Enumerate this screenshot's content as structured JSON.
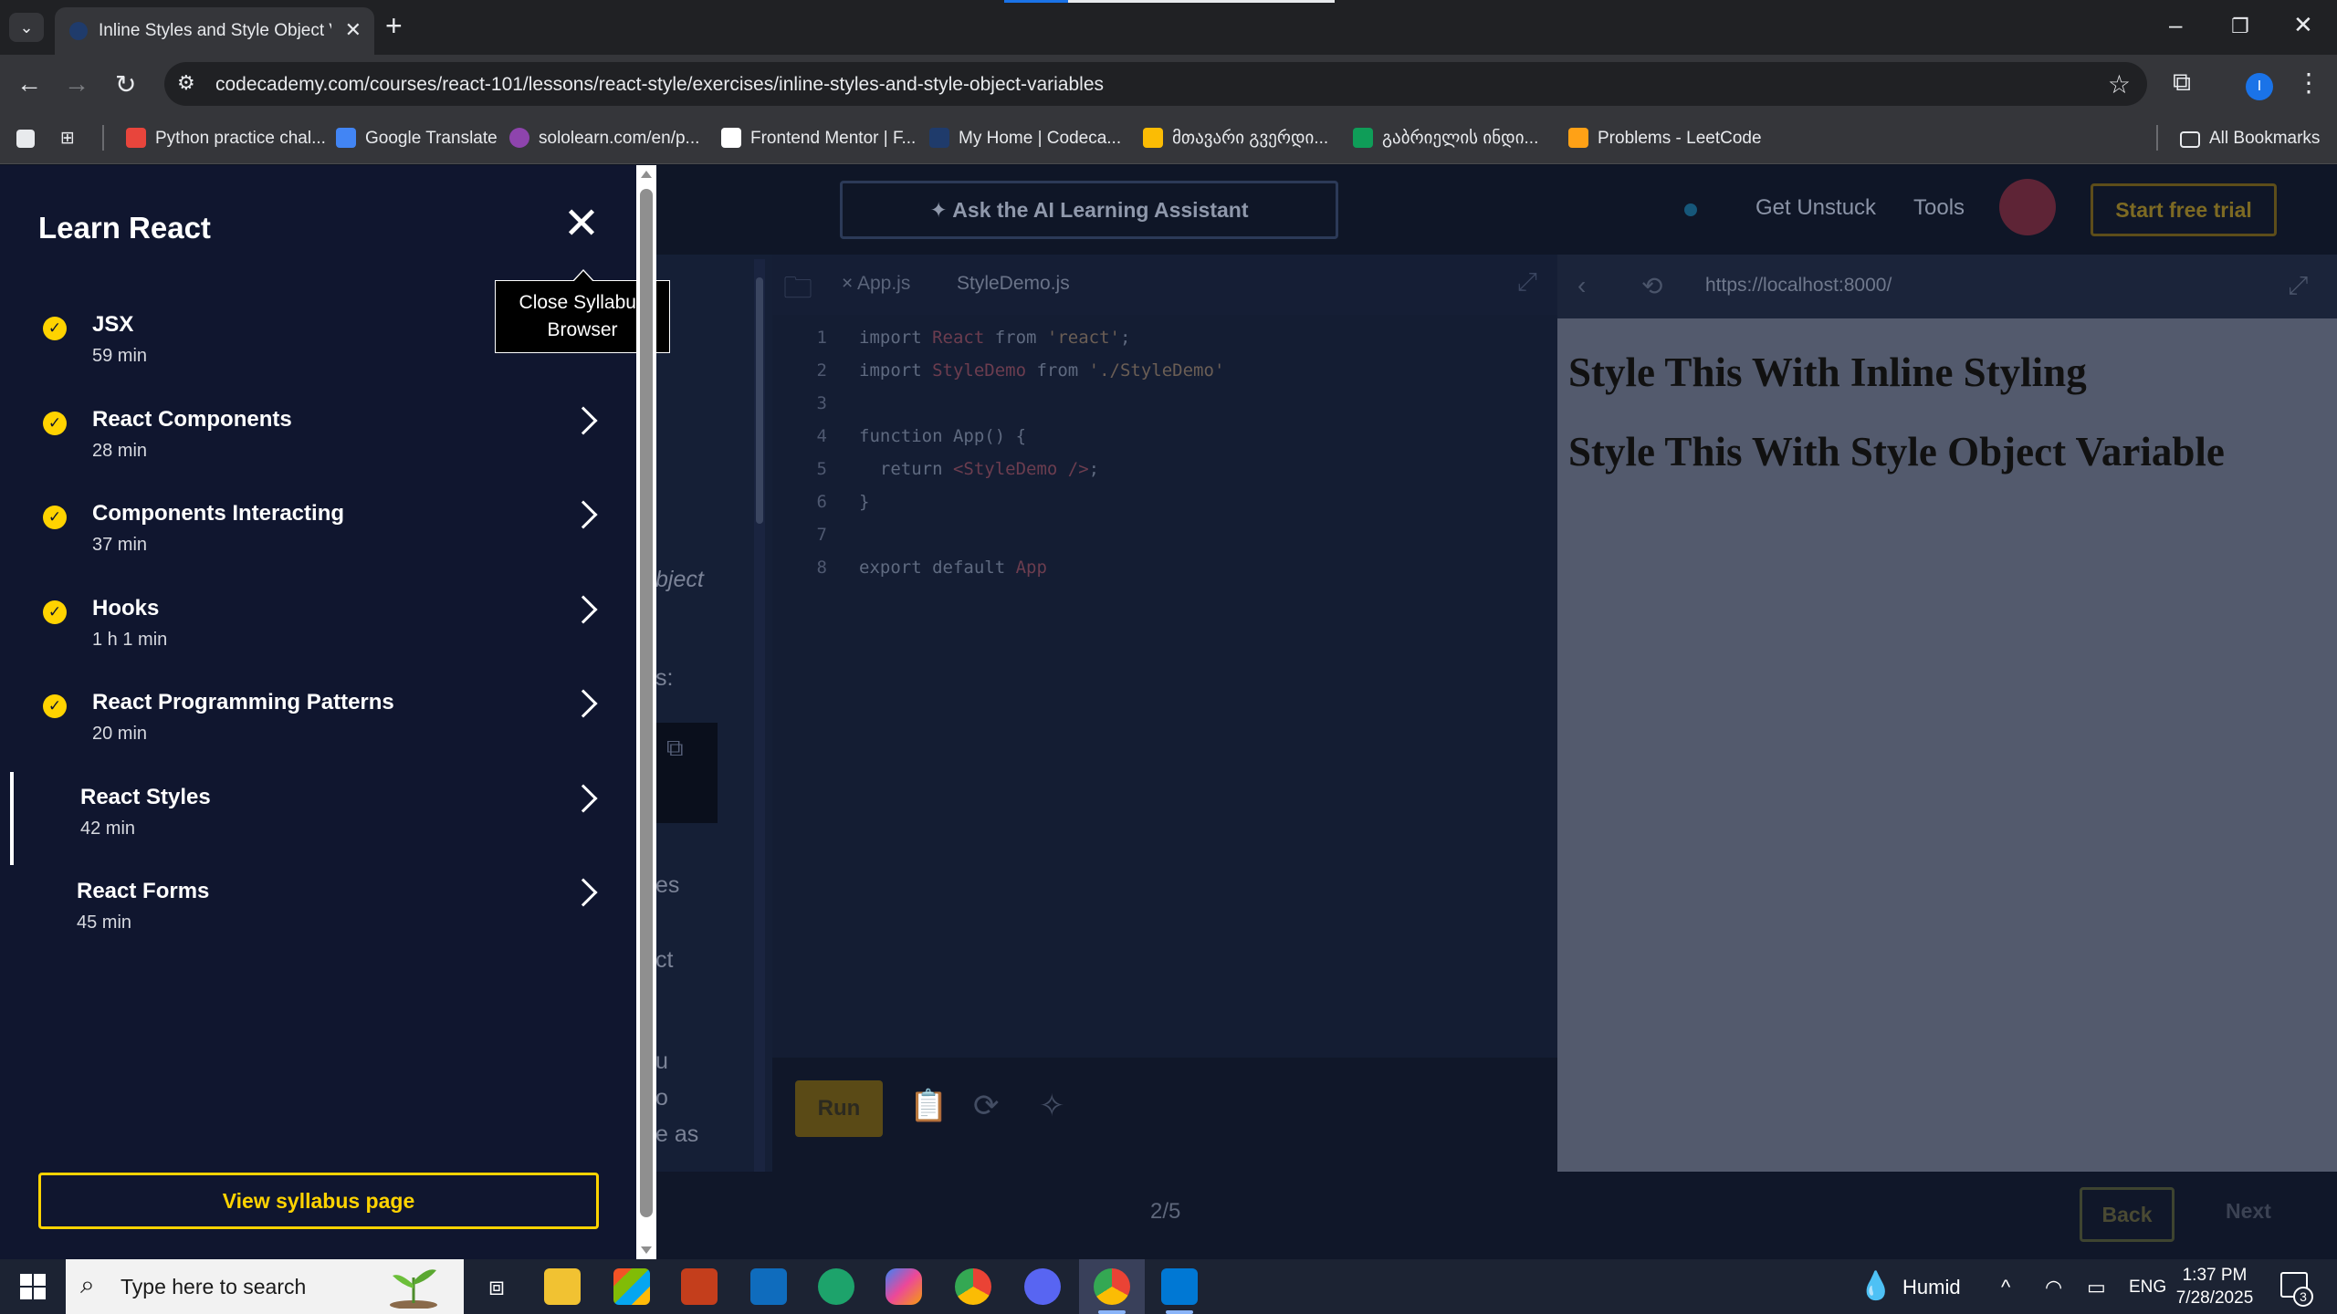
{
  "browser": {
    "tab_title": "Inline Styles and Style Object Va",
    "url": "codecademy.com/courses/react-101/lessons/react-style/exercises/inline-styles-and-style-object-variables",
    "bookmarks": [
      {
        "label": "Python practice chal...",
        "color": "#e8453c"
      },
      {
        "label": "Google Translate",
        "color": "#4285f4"
      },
      {
        "label": "sololearn.com/en/p...",
        "color": "#8e44ad"
      },
      {
        "label": "Frontend Mentor | F...",
        "color": "#ffffff"
      },
      {
        "label": "My Home | Codeca...",
        "color": "#1f3b6b"
      },
      {
        "label": "მთავარი გვერდი...",
        "color": "#fbbc04"
      },
      {
        "label": "გაბრიელის ინდი...",
        "color": "#0f9d58"
      },
      {
        "label": "Problems - LeetCode",
        "color": "#ffa116"
      }
    ],
    "all_bookmarks": "All Bookmarks",
    "profile_initial": "I"
  },
  "nav": {
    "ai_assistant": "Ask the AI Learning Assistant",
    "get_unstuck": "Get Unstuck",
    "tools": "Tools",
    "start_trial": "Start free trial"
  },
  "lesson": {
    "fragments": [
      "bject",
      "s:",
      "es",
      "ct",
      "u",
      "o",
      "e as"
    ]
  },
  "editor": {
    "tabs": [
      "App.js",
      "StyleDemo.js"
    ],
    "run": "Run",
    "lines": [
      {
        "n": "1",
        "parts": [
          [
            "kw",
            "import "
          ],
          [
            "id",
            "React"
          ],
          [
            "kw",
            " from "
          ],
          [
            "str",
            "'react'"
          ],
          [
            "kw",
            ";"
          ]
        ]
      },
      {
        "n": "2",
        "parts": [
          [
            "kw",
            "import "
          ],
          [
            "id",
            "StyleDemo"
          ],
          [
            "kw",
            " from "
          ],
          [
            "str",
            "'./StyleDemo'"
          ]
        ]
      },
      {
        "n": "3",
        "parts": []
      },
      {
        "n": "4",
        "parts": [
          [
            "kw",
            "function App() {"
          ]
        ]
      },
      {
        "n": "5",
        "parts": [
          [
            "kw",
            "  return "
          ],
          [
            "id",
            "<StyleDemo />"
          ],
          [
            "kw",
            ";"
          ]
        ]
      },
      {
        "n": "6",
        "parts": [
          [
            "kw",
            "}"
          ]
        ]
      },
      {
        "n": "7",
        "parts": []
      },
      {
        "n": "8",
        "parts": [
          [
            "kw",
            "export default "
          ],
          [
            "id",
            "App"
          ]
        ]
      }
    ]
  },
  "preview": {
    "url": "https://localhost:8000/",
    "heading1": "Style This With Inline Styling",
    "heading2": "Style This With Style Object Variable"
  },
  "footer": {
    "progress": "2/5",
    "back": "Back",
    "next": "Next"
  },
  "syllabus": {
    "title": "Learn React",
    "close_tooltip": "Close Syllabus Browser",
    "view_syllabus": "View syllabus page",
    "modules": [
      {
        "name": "JSX",
        "duration": "59 min",
        "completed": true
      },
      {
        "name": "React Components",
        "duration": "28 min",
        "completed": true
      },
      {
        "name": "Components Interacting",
        "duration": "37 min",
        "completed": true
      },
      {
        "name": "Hooks",
        "duration": "1 h 1 min",
        "completed": true
      },
      {
        "name": "React Programming Patterns",
        "duration": "20 min",
        "completed": true
      },
      {
        "name": "React Styles",
        "duration": "42 min",
        "completed": false,
        "current": true
      },
      {
        "name": "React Forms",
        "duration": "45 min",
        "completed": false
      }
    ]
  },
  "taskbar": {
    "search_placeholder": "Type here to search",
    "weather": "Humid",
    "language": "ENG",
    "time": "1:37 PM",
    "date": "7/28/2025",
    "notifications": "3"
  }
}
